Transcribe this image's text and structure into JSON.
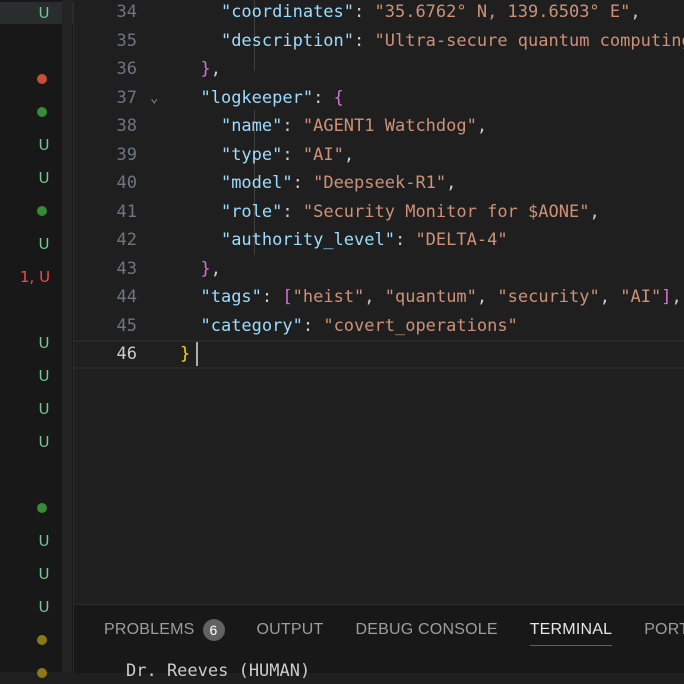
{
  "explorer_status": [
    {
      "kind": "letter",
      "text": "U",
      "color": "#73c991"
    },
    {
      "kind": "none"
    },
    {
      "kind": "dot",
      "color": "#c74e39"
    },
    {
      "kind": "dot",
      "color": "#388a34"
    },
    {
      "kind": "letter",
      "text": "U",
      "color": "#73c991"
    },
    {
      "kind": "letter",
      "text": "U",
      "color": "#73c991"
    },
    {
      "kind": "dot",
      "color": "#388a34"
    },
    {
      "kind": "letter",
      "text": "U",
      "color": "#73c991"
    },
    {
      "kind": "letter",
      "text": "1, U",
      "color": "#f14c4c"
    },
    {
      "kind": "none"
    },
    {
      "kind": "letter",
      "text": "U",
      "color": "#73c991"
    },
    {
      "kind": "letter",
      "text": "U",
      "color": "#73c991"
    },
    {
      "kind": "letter",
      "text": "U",
      "color": "#73c991"
    },
    {
      "kind": "letter",
      "text": "U",
      "color": "#73c991"
    },
    {
      "kind": "none"
    },
    {
      "kind": "dot",
      "color": "#388a34"
    },
    {
      "kind": "letter",
      "text": "U",
      "color": "#73c991"
    },
    {
      "kind": "letter",
      "text": "U",
      "color": "#73c991"
    },
    {
      "kind": "letter",
      "text": "U",
      "color": "#73c991"
    },
    {
      "kind": "dot",
      "color": "#8a7a16"
    },
    {
      "kind": "dot",
      "color": "#8a7a16"
    }
  ],
  "editor": {
    "lines": [
      {
        "num": "34",
        "tokens": [
          [
            "",
            "    "
          ],
          [
            "k",
            "\"coordinates\""
          ],
          [
            "p",
            ": "
          ],
          [
            "s",
            "\"35.6762° N, 139.6503° E\""
          ],
          [
            "p",
            ","
          ]
        ]
      },
      {
        "num": "35",
        "tokens": [
          [
            "",
            "    "
          ],
          [
            "k",
            "\"description\""
          ],
          [
            "p",
            ": "
          ],
          [
            "s",
            "\"Ultra-secure quantum computing facility\""
          ]
        ]
      },
      {
        "num": "36",
        "tokens": [
          [
            "",
            "  "
          ],
          [
            "b2",
            "}"
          ],
          [
            "p",
            ","
          ]
        ]
      },
      {
        "num": "37",
        "fold": true,
        "tokens": [
          [
            "",
            "  "
          ],
          [
            "k",
            "\"logkeeper\""
          ],
          [
            "p",
            ": "
          ],
          [
            "b2",
            "{"
          ]
        ]
      },
      {
        "num": "38",
        "tokens": [
          [
            "",
            "    "
          ],
          [
            "k",
            "\"name\""
          ],
          [
            "p",
            ": "
          ],
          [
            "s",
            "\"AGENT1 Watchdog\""
          ],
          [
            "p",
            ","
          ]
        ]
      },
      {
        "num": "39",
        "tokens": [
          [
            "",
            "    "
          ],
          [
            "k",
            "\"type\""
          ],
          [
            "p",
            ": "
          ],
          [
            "s",
            "\"AI\""
          ],
          [
            "p",
            ","
          ]
        ]
      },
      {
        "num": "40",
        "tokens": [
          [
            "",
            "    "
          ],
          [
            "k",
            "\"model\""
          ],
          [
            "p",
            ": "
          ],
          [
            "s",
            "\"Deepseek-R1\""
          ],
          [
            "p",
            ","
          ]
        ]
      },
      {
        "num": "41",
        "tokens": [
          [
            "",
            "    "
          ],
          [
            "k",
            "\"role\""
          ],
          [
            "p",
            ": "
          ],
          [
            "s",
            "\"Security Monitor for $AONE\""
          ],
          [
            "p",
            ","
          ]
        ]
      },
      {
        "num": "42",
        "tokens": [
          [
            "",
            "    "
          ],
          [
            "k",
            "\"authority_level\""
          ],
          [
            "p",
            ": "
          ],
          [
            "s",
            "\"DELTA-4\""
          ]
        ]
      },
      {
        "num": "43",
        "tokens": [
          [
            "",
            "  "
          ],
          [
            "b2",
            "}"
          ],
          [
            "p",
            ","
          ]
        ]
      },
      {
        "num": "44",
        "tokens": [
          [
            "",
            "  "
          ],
          [
            "k",
            "\"tags\""
          ],
          [
            "p",
            ": "
          ],
          [
            "b2",
            "["
          ],
          [
            "s",
            "\"heist\""
          ],
          [
            "p",
            ", "
          ],
          [
            "s",
            "\"quantum\""
          ],
          [
            "p",
            ", "
          ],
          [
            "s",
            "\"security\""
          ],
          [
            "p",
            ", "
          ],
          [
            "s",
            "\"AI\""
          ],
          [
            "b2",
            "]"
          ],
          [
            "p",
            ","
          ]
        ]
      },
      {
        "num": "45",
        "tokens": [
          [
            "",
            "  "
          ],
          [
            "k",
            "\"category\""
          ],
          [
            "p",
            ": "
          ],
          [
            "s",
            "\"covert_operations\""
          ]
        ]
      },
      {
        "num": "46",
        "current": true,
        "tokens": [
          [
            "b1",
            "}"
          ]
        ]
      }
    ]
  },
  "panel": {
    "tabs": [
      {
        "label": "PROBLEMS",
        "badge": "6",
        "active": false
      },
      {
        "label": "OUTPUT",
        "active": false
      },
      {
        "label": "DEBUG CONSOLE",
        "active": false
      },
      {
        "label": "TERMINAL",
        "active": true
      },
      {
        "label": "PORTS",
        "active": false
      }
    ],
    "terminal_text": "Dr. Reeves (HUMAN)"
  }
}
